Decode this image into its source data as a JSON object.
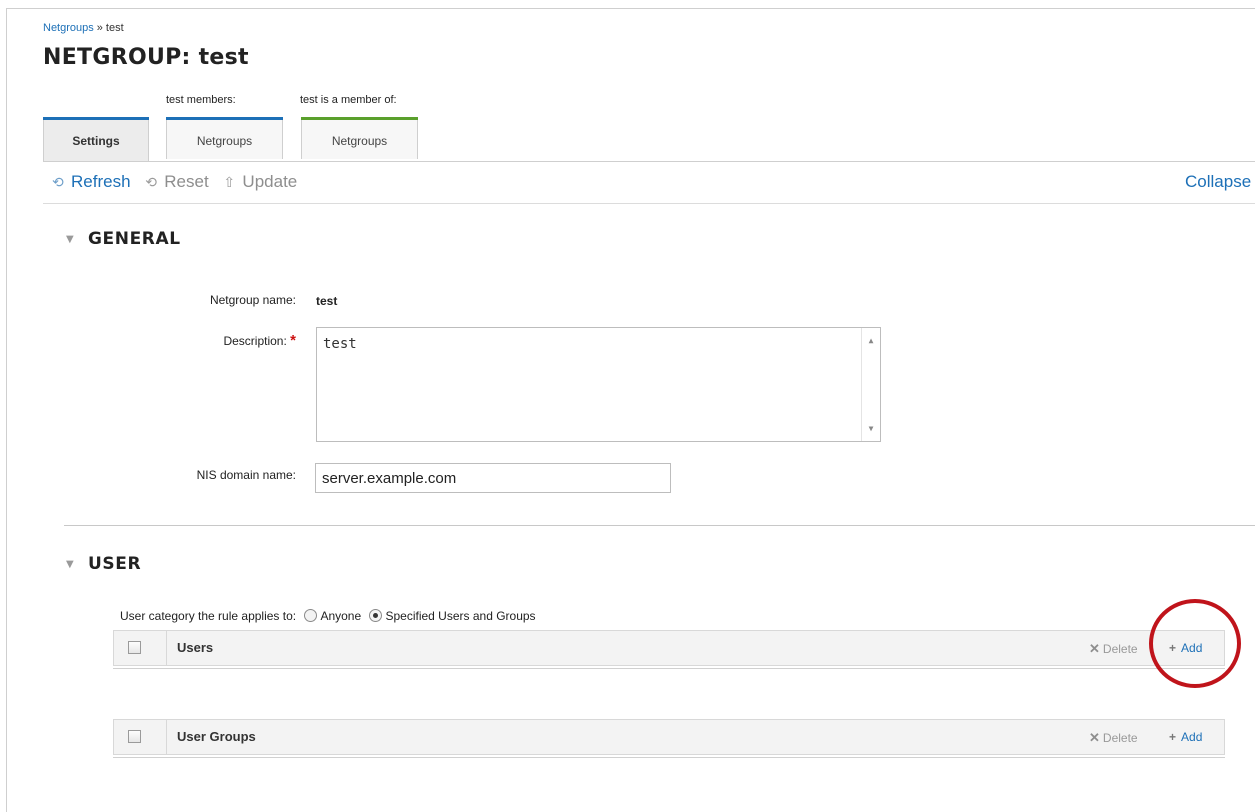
{
  "breadcrumb": {
    "parent": "Netgroups",
    "separator": "»",
    "current": "test"
  },
  "page": {
    "kind": "NETGROUP:",
    "name": "test"
  },
  "tab_captions": {
    "members": "test members:",
    "member_of": "test is a member of:"
  },
  "tabs": [
    {
      "label": "Settings",
      "active": true,
      "color": "#1d70b7"
    },
    {
      "label": "Netgroups",
      "active": false,
      "color": "#1d70b7"
    },
    {
      "label": "Netgroups",
      "active": false,
      "color": "#5aa02c"
    }
  ],
  "toolbar": {
    "refresh": "Refresh",
    "reset": "Reset",
    "update": "Update",
    "collapse": "Collapse"
  },
  "general": {
    "header": "GENERAL",
    "netgroup_name_label": "Netgroup name:",
    "netgroup_name_value": "test",
    "description_label": "Description:",
    "required_marker": "*",
    "description_value": "test",
    "nis_domain_label": "NIS domain name:",
    "nis_domain_value": "server.example.com"
  },
  "user": {
    "header": "USER",
    "category_label": "User category the rule applies to:",
    "option_anyone": "Anyone",
    "option_specified": "Specified Users and Groups",
    "selected_option": "Specified Users and Groups",
    "tables": [
      {
        "title": "Users",
        "delete": "Delete",
        "add": "Add"
      },
      {
        "title": "User Groups",
        "delete": "Delete",
        "add": "Add"
      }
    ]
  },
  "colors": {
    "link": "#1d70b7",
    "highlight": "#c0141b",
    "required": "#cc1111"
  }
}
